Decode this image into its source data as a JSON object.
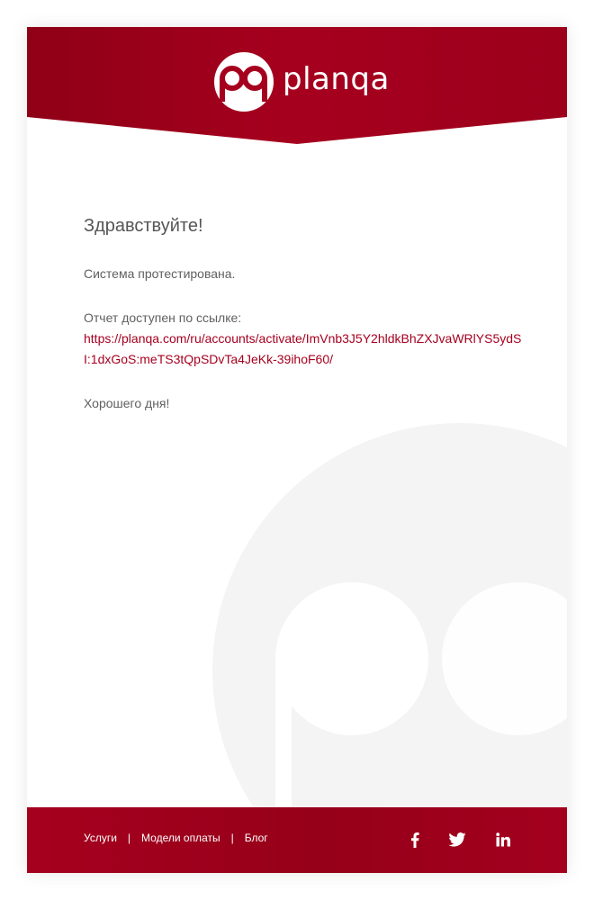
{
  "brand": {
    "name": "planqa",
    "header_color": "#a6001f",
    "accent_color": "#a6001f"
  },
  "email": {
    "greeting": "Здравствуйте!",
    "line1": "Система протестирована.",
    "line2": "Отчет доступен по ссылке:",
    "link": "https://planqa.com/ru/accounts/activate/ImVnb3J5Y2hldkBhZXJvaWRlYS5ydSI:1dxGoS:meTS3tQpSDvTa4JeKk-39ihoF60/",
    "closing": "Хорошего дня!"
  },
  "footer": {
    "nav": [
      "Услуги",
      "Модели оплаты",
      "Блог"
    ],
    "separator": "|",
    "social_icons": [
      "facebook-icon",
      "twitter-icon",
      "linkedin-icon"
    ]
  }
}
